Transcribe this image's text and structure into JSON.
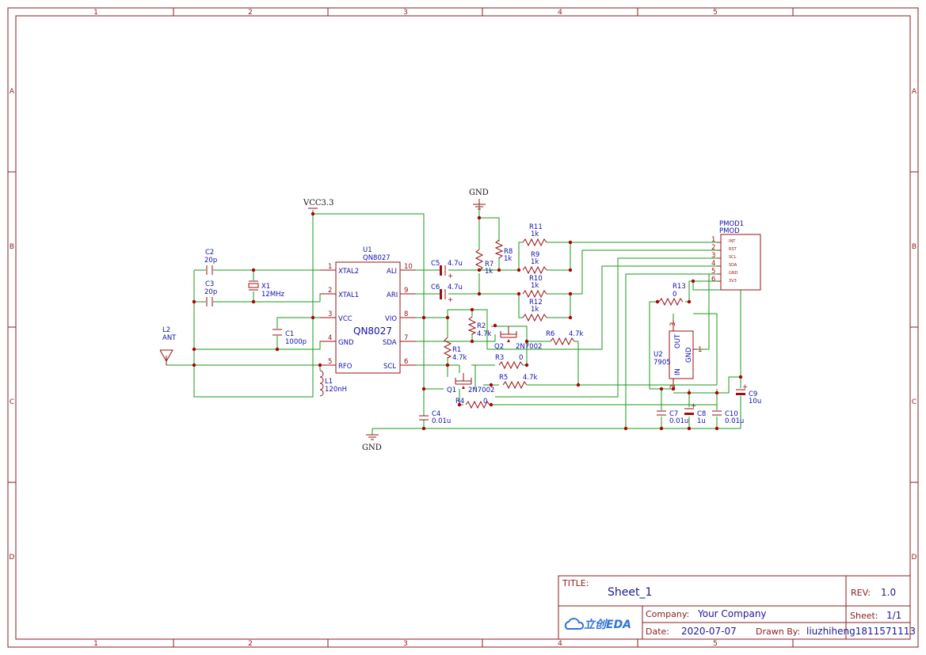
{
  "sheet": {
    "columns": [
      "1",
      "2",
      "3",
      "4",
      "5"
    ],
    "rows": [
      "A",
      "B",
      "C",
      "D"
    ]
  },
  "title_block": {
    "title_label": "TITLE:",
    "title": "Sheet_1",
    "rev_label": "REV:",
    "rev": "1.0",
    "company_label": "Company:",
    "company": "Your Company",
    "sheet_label": "Sheet:",
    "sheet_no": "1/1",
    "date_label": "Date:",
    "date": "2020-07-07",
    "drawn_label": "Drawn By:",
    "drawn_by": "liuzhiheng1811571113",
    "logo_text": "立创EDA"
  },
  "nets": {
    "vcc": "VCC3.3",
    "gnd_top": "GND",
    "gnd_bottom": "GND"
  },
  "components": {
    "u1": {
      "ref": "U1",
      "value": "QN8027",
      "body_label": "QN8027",
      "pins_left": [
        {
          "num": "1",
          "name": "XTAL2"
        },
        {
          "num": "2",
          "name": "XTAL1"
        },
        {
          "num": "3",
          "name": "VCC"
        },
        {
          "num": "4",
          "name": "GND"
        },
        {
          "num": "5",
          "name": "RFO"
        }
      ],
      "pins_right": [
        {
          "num": "10",
          "name": "ALI"
        },
        {
          "num": "9",
          "name": "ARI"
        },
        {
          "num": "8",
          "name": "VIO"
        },
        {
          "num": "7",
          "name": "SDA"
        },
        {
          "num": "6",
          "name": "SCL"
        }
      ]
    },
    "c2": {
      "ref": "C2",
      "value": "20p"
    },
    "c3": {
      "ref": "C3",
      "value": "20p"
    },
    "x1": {
      "ref": "X1",
      "value": "12MHz"
    },
    "c1": {
      "ref": "C1",
      "value": "1000p"
    },
    "l2": {
      "ref": "L2",
      "value": "ANT"
    },
    "l1": {
      "ref": "L1",
      "value": "120nH"
    },
    "c4": {
      "ref": "C4",
      "value": "0.01u"
    },
    "c5": {
      "ref": "C5",
      "value": "4.7u"
    },
    "c6": {
      "ref": "C6",
      "value": "4.7u"
    },
    "r7": {
      "ref": "R7",
      "value": "1k"
    },
    "r8": {
      "ref": "R8",
      "value": "1k"
    },
    "r11": {
      "ref": "R11",
      "value": "1k"
    },
    "r9": {
      "ref": "R9",
      "value": "1k"
    },
    "r10": {
      "ref": "R10",
      "value": "1k"
    },
    "r12": {
      "ref": "R12",
      "value": "1k"
    },
    "r2": {
      "ref": "R2",
      "value": "4.7k"
    },
    "r1": {
      "ref": "R1",
      "value": "4.7k"
    },
    "q2": {
      "ref": "Q2",
      "value": "2N7002"
    },
    "q1": {
      "ref": "Q1",
      "value": "2N7002"
    },
    "r6": {
      "ref": "R6",
      "value": "4.7k"
    },
    "r3": {
      "ref": "R3",
      "value": "0"
    },
    "r5": {
      "ref": "R5",
      "value": "4.7k"
    },
    "r4": {
      "ref": "R4",
      "value": "0"
    },
    "r13": {
      "ref": "R13",
      "value": "0"
    },
    "u2": {
      "ref": "U2",
      "value": "7905",
      "pins": [
        {
          "num": "3",
          "name": "OUT"
        },
        {
          "num": "1",
          "name": "GND"
        },
        {
          "num": "2",
          "name": "IN"
        }
      ]
    },
    "c7": {
      "ref": "C7",
      "value": "0.01u"
    },
    "c8": {
      "ref": "C8",
      "value": "1u"
    },
    "c10": {
      "ref": "C10",
      "value": "0.01u"
    },
    "c9": {
      "ref": "C9",
      "value": "10u"
    },
    "pmod1": {
      "ref": "PMOD1",
      "value": "PMOD",
      "pins": [
        {
          "num": "1",
          "name": "INT"
        },
        {
          "num": "2",
          "name": "RST"
        },
        {
          "num": "3",
          "name": "SCL"
        },
        {
          "num": "4",
          "name": "SDA"
        },
        {
          "num": "5",
          "name": "GND"
        },
        {
          "num": "6",
          "name": "3V3"
        }
      ]
    }
  },
  "colors": {
    "frame": "#8a1d1d",
    "wire": "#1a9a1a",
    "symbol": "#9a1010",
    "label": "#1010b0",
    "junction": "#b00000"
  }
}
